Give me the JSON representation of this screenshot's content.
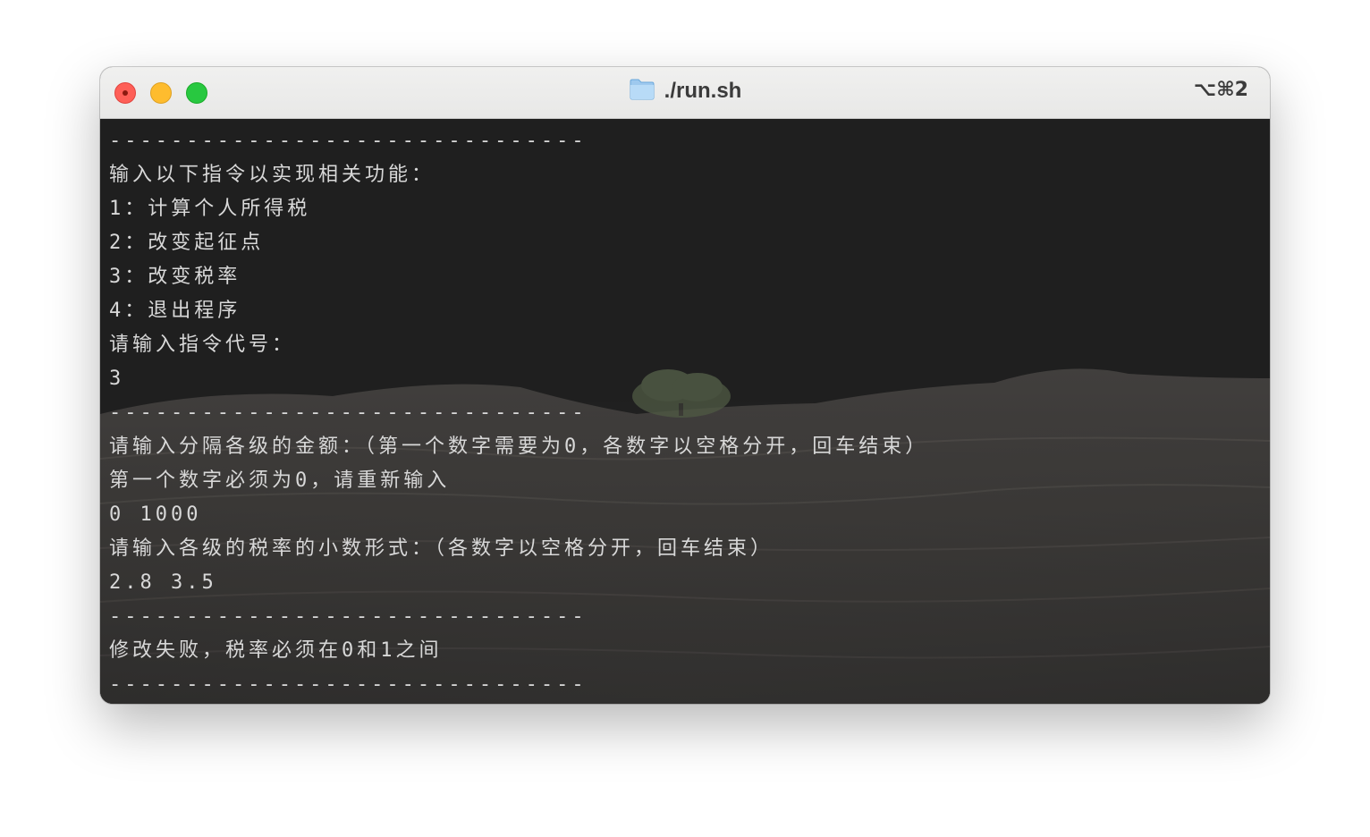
{
  "window": {
    "title": "./run.sh",
    "shortcut": "⌥⌘2",
    "title_icon": "folder-icon",
    "traffic_lights": {
      "close": "#fe5f57",
      "minimize": "#febc2e",
      "maximize": "#28c840"
    }
  },
  "terminal": {
    "text_color": "#d8d8d8",
    "lines": [
      "-------------------------------",
      "输入以下指令以实现相关功能：",
      "1：计算个人所得税",
      "2：改变起征点",
      "3：改变税率",
      "4：退出程序",
      "请输入指令代号：",
      "3",
      "-------------------------------",
      "请输入分隔各级的金额：（第一个数字需要为0，各数字以空格分开，回车结束）",
      "第一个数字必须为0，请重新输入",
      "0 1000",
      "请输入各级的税率的小数形式：（各数字以空格分开，回车结束）",
      "2.8 3.5",
      "-------------------------------",
      "修改失败，税率必须在0和1之间",
      "-------------------------------"
    ]
  }
}
